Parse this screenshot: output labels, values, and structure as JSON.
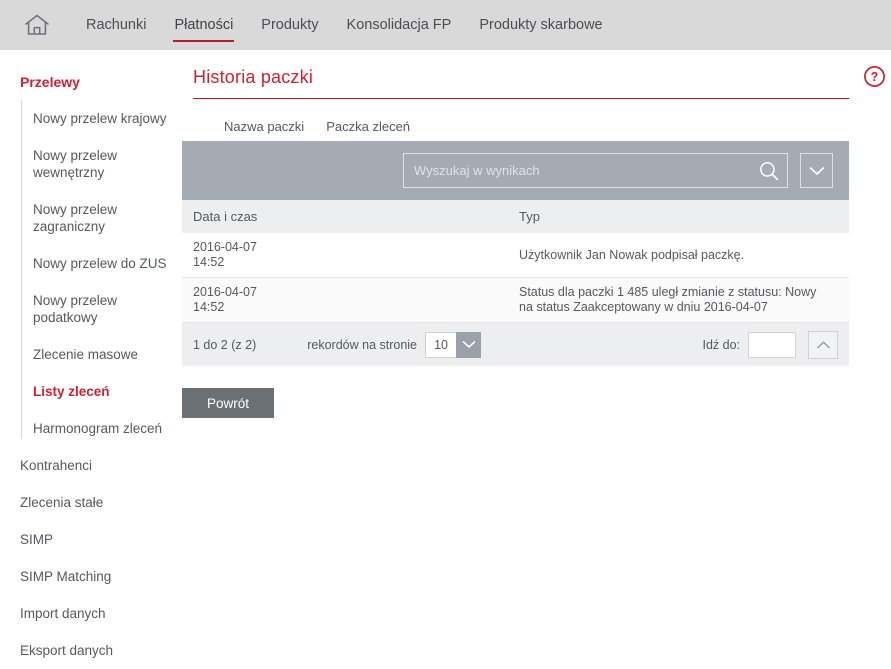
{
  "topbar": {
    "home_icon": "home-icon",
    "nav": [
      {
        "label": "Rachunki",
        "active": false
      },
      {
        "label": "Płatności",
        "active": true
      },
      {
        "label": "Produkty",
        "active": false
      },
      {
        "label": "Konsolidacja FP",
        "active": false
      },
      {
        "label": "Produkty skarbowe",
        "active": false
      }
    ]
  },
  "sidebar": {
    "section_label": "Przelewy",
    "sub_items": [
      {
        "label": "Nowy przelew krajowy",
        "highlighted": false
      },
      {
        "label": "Nowy przelew wewnętrzny",
        "highlighted": false
      },
      {
        "label": "Nowy przelew zagraniczny",
        "highlighted": false
      },
      {
        "label": "Nowy przelew do ZUS",
        "highlighted": false
      },
      {
        "label": "Nowy przelew podatkowy",
        "highlighted": false
      },
      {
        "label": "Zlecenie masowe",
        "highlighted": false
      },
      {
        "label": "Listy zleceń",
        "highlighted": true
      },
      {
        "label": "Harmonogram zleceń",
        "highlighted": false
      }
    ],
    "items": [
      {
        "label": "Kontrahenci"
      },
      {
        "label": "Zlecenia stałe"
      },
      {
        "label": "SIMP"
      },
      {
        "label": "SIMP Matching"
      },
      {
        "label": "Import danych"
      },
      {
        "label": "Eksport danych"
      }
    ]
  },
  "main": {
    "page_title": "Historia paczki",
    "help_icon": "question-mark-circle-icon",
    "tabs": [
      {
        "label": "Nazwa paczki"
      },
      {
        "label": "Paczka zleceń"
      }
    ],
    "search": {
      "value": "",
      "placeholder": "Wyszukaj w wynikach",
      "search_icon": "magnifier-icon",
      "filter_icon": "chevron-down-icon"
    },
    "table": {
      "columns": [
        "Data i czas",
        "Typ"
      ],
      "rows": [
        {
          "date": "2016-04-07",
          "time": "14:52",
          "type": "Użytkownik Jan Nowak podpisał paczkę."
        },
        {
          "date": "2016-04-07",
          "time": "14:52",
          "type": "Status dla paczki 1 485 uległ zmianie z statusu: Nowy na status Zaakceptowany w dniu 2016-04-07"
        }
      ]
    },
    "footer": {
      "count_label": "1 do 2 (z 2)",
      "per_page_label": "rekordów na stronie",
      "per_page_value": "10",
      "per_page_icon": "chevron-down-icon",
      "goto_label": "Idź do:",
      "goto_value": "",
      "goto_icon": "chevron-up-icon"
    },
    "back_button": "Powrót"
  },
  "colors": {
    "brand_red": "#cf1f30",
    "accent_underline": "#b41f36",
    "topbar_bg": "#d9d9d9",
    "search_bg": "#a4abb3",
    "table_header_bg": "#eceef0",
    "back_button_bg": "#6b7075",
    "text": "#54595f"
  }
}
